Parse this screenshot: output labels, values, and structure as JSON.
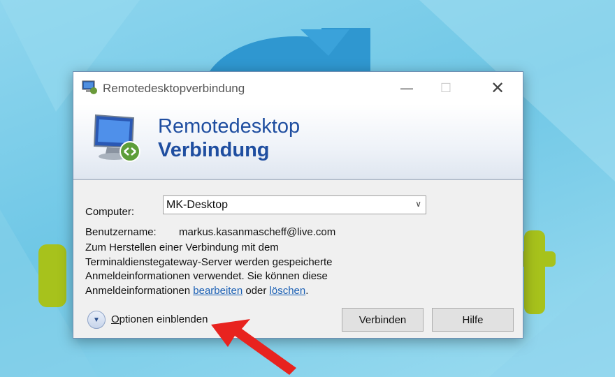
{
  "window": {
    "title": "Remotedesktopverbindung",
    "minimize_glyph": "—",
    "maximize_glyph": "☐",
    "close_glyph": "✕",
    "icon": "remote-desktop-icon"
  },
  "banner": {
    "line1": "Remotedesktop",
    "line2": "Verbindung",
    "icon": "remote-desktop-monitor-icon"
  },
  "form": {
    "computer_label": "Computer:",
    "computer_value": "MK-Desktop",
    "username_label": "Benutzername:",
    "username_value": "markus.kasanmascheff@live.com",
    "info_text_before": "Zum Herstellen einer Verbindung mit dem Terminaldienstegateway-Server werden gespeicherte Anmeldeinformationen verwendet. Sie können diese Anmeldeinformationen ",
    "link_edit": "bearbeiten",
    "info_text_middle": " oder ",
    "link_delete": "löschen",
    "info_text_end": "."
  },
  "footer": {
    "options_label_first": "O",
    "options_label_rest": "ptionen einblenden",
    "connect_button": "Verbinden",
    "help_button": "Hilfe"
  },
  "colors": {
    "accent": "#1f4ea0",
    "link": "#1a5fb4",
    "annotation_arrow": "#e8231f",
    "background": "#7fd0ea"
  }
}
